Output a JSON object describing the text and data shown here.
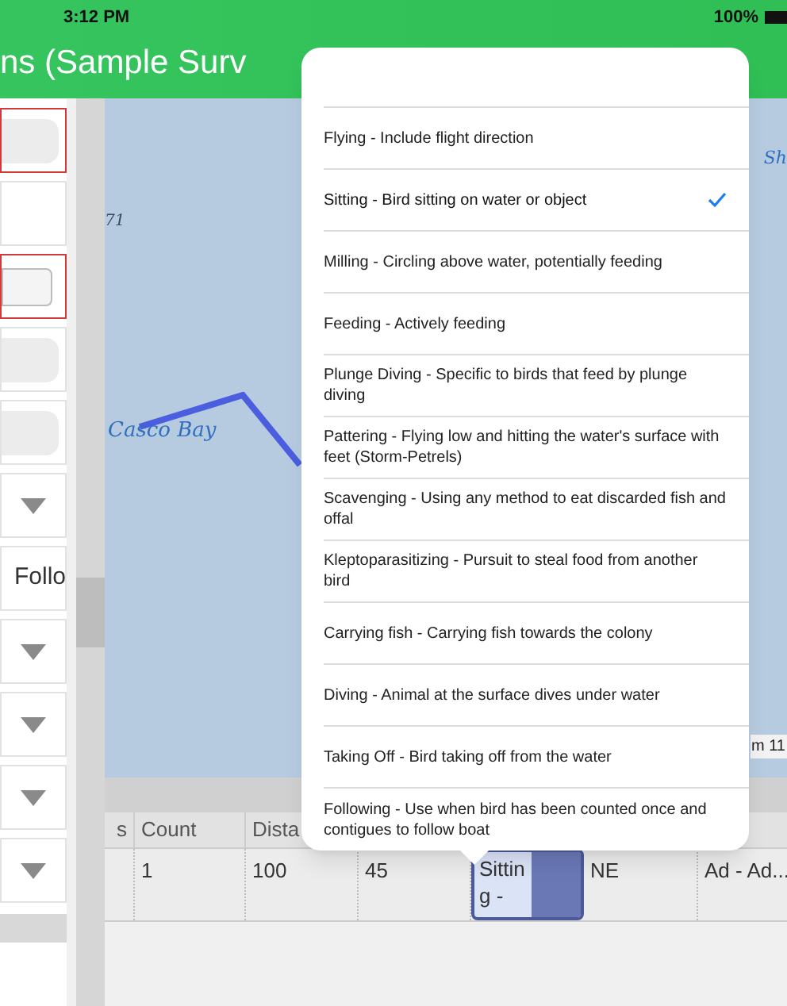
{
  "status_bar": {
    "time": "3:12 PM",
    "battery": "100%"
  },
  "header": {
    "title": "ns (Sample Surv"
  },
  "left_panel": {
    "rows": [
      {
        "kind": "error"
      },
      {
        "kind": "blank"
      },
      {
        "kind": "error-input"
      },
      {
        "kind": "field"
      },
      {
        "kind": "field"
      },
      {
        "kind": "dropdown"
      },
      {
        "kind": "value",
        "text": "Follo"
      },
      {
        "kind": "dropdown"
      },
      {
        "kind": "dropdown"
      },
      {
        "kind": "dropdown"
      },
      {
        "kind": "dropdown"
      }
    ]
  },
  "map": {
    "labels": [
      "71",
      "Casco Bay"
    ],
    "edge_label_top": "Sh",
    "edge_label_bottom": "m 11"
  },
  "table": {
    "columns": [
      "s",
      "Count",
      "Dista"
    ],
    "rows": [
      {
        "cells": [
          {
            "text": "",
            "selected": false
          },
          {
            "text": "1",
            "selected": false
          },
          {
            "text": "100",
            "selected": false
          },
          {
            "text": "45",
            "selected": false
          },
          {
            "text": "Sitting -",
            "selected": true
          },
          {
            "text": "NE",
            "selected": false
          },
          {
            "text": "Ad - Ad...",
            "selected": false
          }
        ]
      }
    ]
  },
  "dropdown": {
    "items": [
      {
        "label": "Flying - Include flight direction",
        "selected": false
      },
      {
        "label": "Sitting - Bird sitting on water or object",
        "selected": true
      },
      {
        "label": "Milling - Circling above water, potentially feeding",
        "selected": false
      },
      {
        "label": "Feeding - Actively feeding",
        "selected": false
      },
      {
        "label": "Plunge Diving - Specific to birds that feed by plunge diving",
        "selected": false
      },
      {
        "label": "Pattering - Flying low and hitting the water's surface with feet (Storm-Petrels)",
        "selected": false
      },
      {
        "label": "Scavenging - Using any method to eat discarded fish and offal",
        "selected": false
      },
      {
        "label": "Kleptoparasitizing - Pursuit to steal food from another bird",
        "selected": false
      },
      {
        "label": "Carrying fish - Carrying fish towards the colony",
        "selected": false
      },
      {
        "label": "Diving - Animal at the surface dives under water",
        "selected": false
      },
      {
        "label": "Taking Off - Bird taking off from the water",
        "selected": false
      },
      {
        "label": "Following - Use when bird has been counted once and contigues to follow boat",
        "selected": false
      }
    ]
  }
}
